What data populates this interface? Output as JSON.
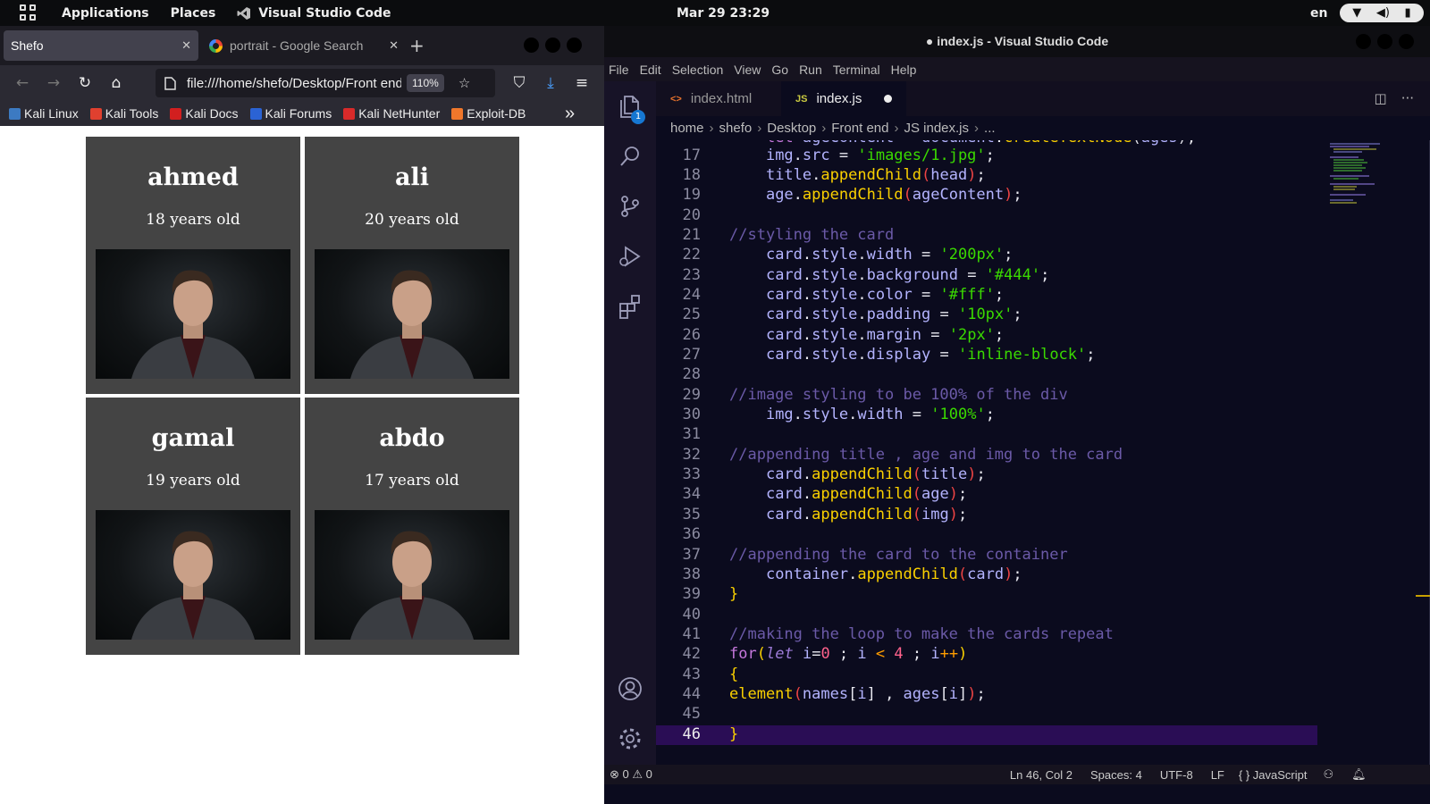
{
  "top_panel": {
    "applications": "Applications",
    "places": "Places",
    "active_app": "Visual Studio Code",
    "clock": "Mar 29  23:29",
    "lang": "en"
  },
  "browser": {
    "tabs": [
      {
        "label": "Shefo",
        "active": true
      },
      {
        "label": "portrait - Google Search",
        "active": false
      }
    ],
    "url": "file:///home/shefo/Desktop/Front end",
    "zoom": "110%",
    "bookmarks": [
      {
        "label": "Kali Linux",
        "color": "#3c7ac2"
      },
      {
        "label": "Kali Tools",
        "color": "#e0402f"
      },
      {
        "label": "Kali Docs",
        "color": "#d21f1f"
      },
      {
        "label": "Kali Forums",
        "color": "#2b63d4"
      },
      {
        "label": "Kali NetHunter",
        "color": "#d92a2a"
      },
      {
        "label": "Exploit-DB",
        "color": "#f0772b"
      }
    ],
    "cards": [
      {
        "name": "ahmed",
        "age": "18 years old"
      },
      {
        "name": "ali",
        "age": "20 years old"
      },
      {
        "name": "gamal",
        "age": "19 years old"
      },
      {
        "name": "abdo",
        "age": "17 years old"
      }
    ]
  },
  "vscode": {
    "title": "● index.js - Visual Studio Code",
    "menu": [
      "File",
      "Edit",
      "Selection",
      "View",
      "Go",
      "Run",
      "Terminal",
      "Help"
    ],
    "explorer_badge": "1",
    "tabs": [
      {
        "label": "index.html",
        "icon": "<>",
        "active": false
      },
      {
        "label": "index.js",
        "icon": "JS",
        "active": true,
        "modified": true
      }
    ],
    "breadcrumb": [
      "home",
      "shefo",
      "Desktop",
      "Front end",
      "JS index.js",
      "..."
    ],
    "line_numbers": [
      "17",
      "18",
      "19",
      "20",
      "21",
      "22",
      "23",
      "24",
      "25",
      "26",
      "27",
      "28",
      "29",
      "30",
      "31",
      "32",
      "33",
      "34",
      "35",
      "36",
      "37",
      "38",
      "39",
      "40",
      "41",
      "42",
      "43",
      "44",
      "45",
      "46"
    ],
    "status": {
      "errors": "0",
      "warnings": "0",
      "position": "Ln 46, Col 2",
      "spaces": "Spaces: 4",
      "encoding": "UTF-8",
      "eol": "LF",
      "language": "JavaScript"
    }
  },
  "colors": {
    "card_bg": "#444444",
    "editor_bg": "#0b0b1e",
    "activity_bg": "#171327",
    "current_line": "#2a0d55"
  }
}
